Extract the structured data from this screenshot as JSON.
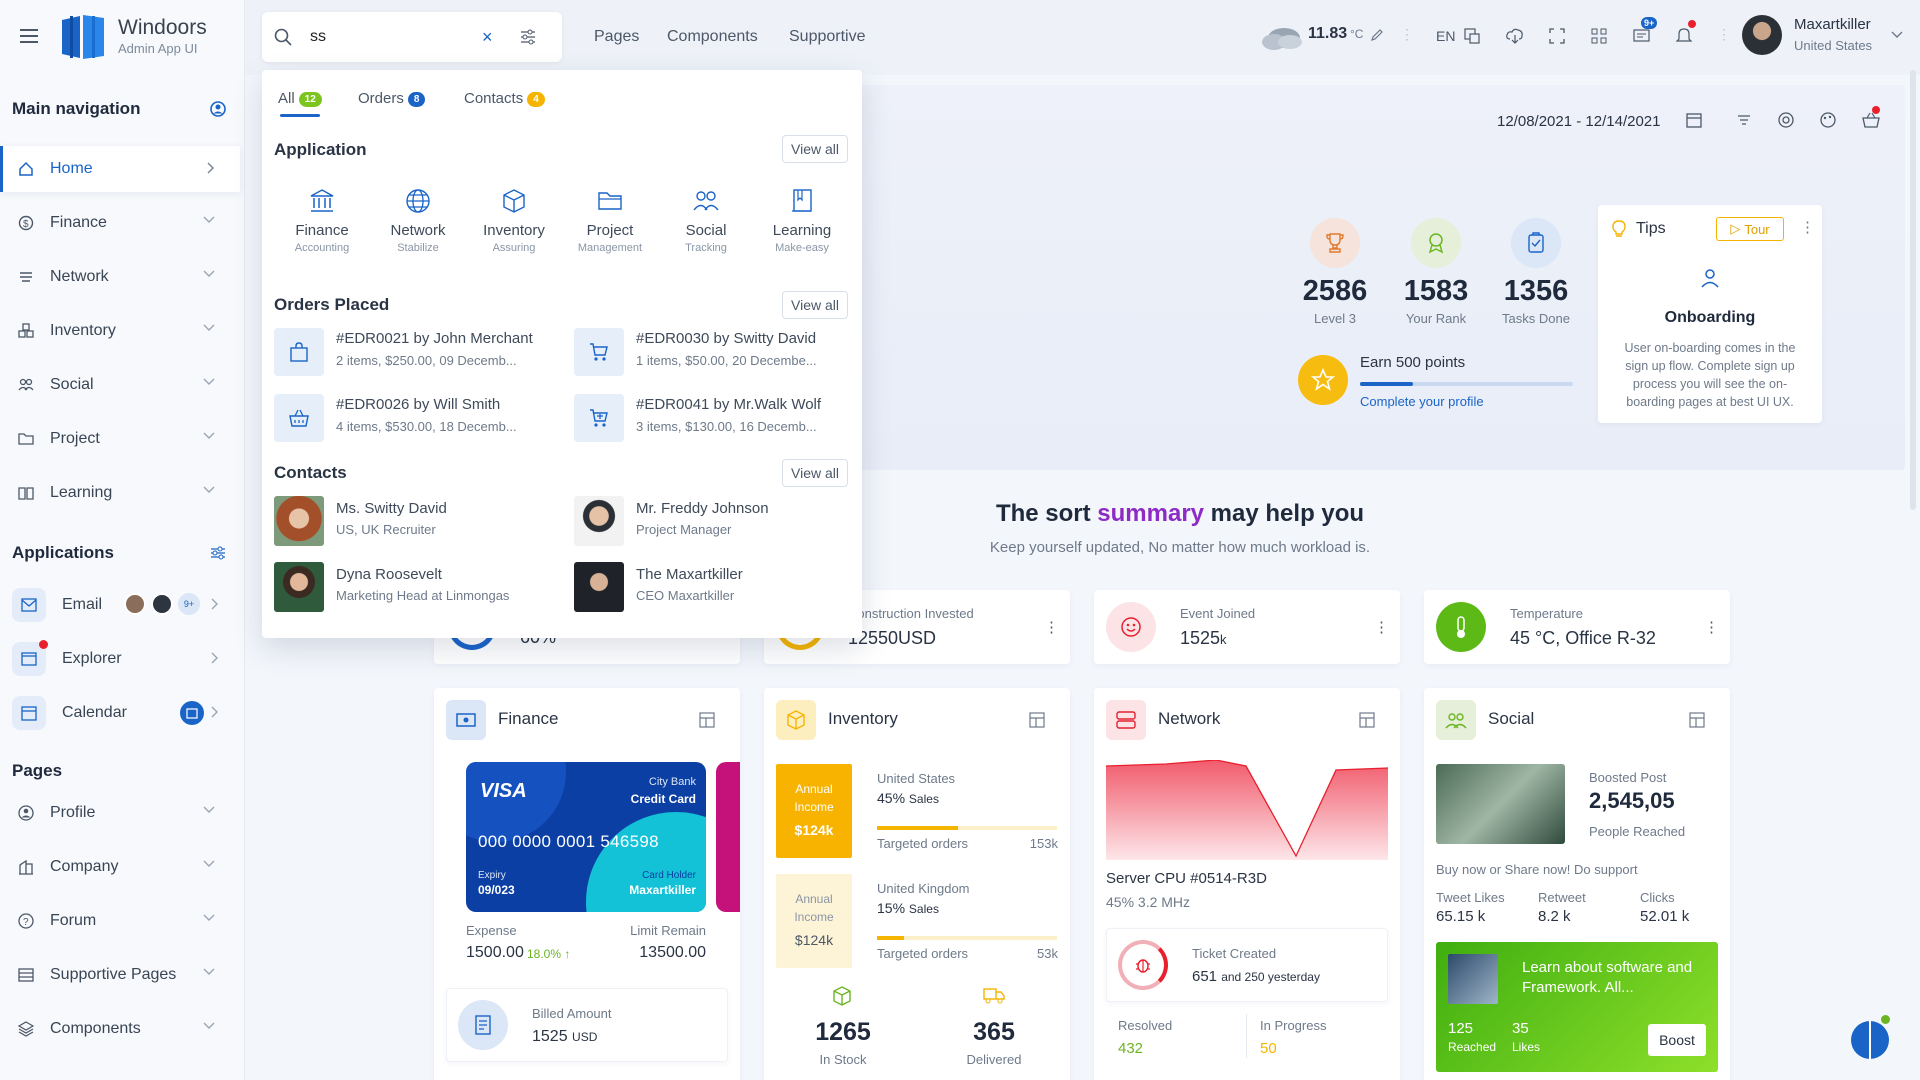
{
  "app": {
    "name": "Windoors",
    "subtitle": "Admin App UI"
  },
  "sidebar": {
    "main_nav_title": "Main navigation",
    "nav": [
      {
        "label": "Home",
        "active": true
      },
      {
        "label": "Finance"
      },
      {
        "label": "Network"
      },
      {
        "label": "Inventory"
      },
      {
        "label": "Social"
      },
      {
        "label": "Project"
      },
      {
        "label": "Learning"
      }
    ],
    "applications_title": "Applications",
    "apps": [
      {
        "label": "Email",
        "badge": "9+"
      },
      {
        "label": "Explorer"
      },
      {
        "label": "Calendar"
      }
    ],
    "pages_title": "Pages",
    "pages": [
      {
        "label": "Profile"
      },
      {
        "label": "Company"
      },
      {
        "label": "Forum"
      },
      {
        "label": "Supportive Pages"
      },
      {
        "label": "Components"
      }
    ]
  },
  "topbar": {
    "search_value": "ss",
    "links": [
      "Pages",
      "Components",
      "Supportive"
    ],
    "weather_temp": "11.83",
    "weather_unit": "°C",
    "lang": "EN",
    "chat_badge": "9+",
    "user_name": "Maxartkiller",
    "user_location": "United States"
  },
  "search_dropdown": {
    "tabs": [
      {
        "label": "All",
        "count": "12",
        "color": "#7cc520"
      },
      {
        "label": "Orders",
        "count": "8",
        "color": "#1a64c8"
      },
      {
        "label": "Contacts",
        "count": "4",
        "color": "#f5b400"
      }
    ],
    "application_title": "Application",
    "view_all": "View all",
    "apps": [
      {
        "title": "Finance",
        "sub": "Accounting",
        "icon": "bank-icon"
      },
      {
        "title": "Network",
        "sub": "Stabilize",
        "icon": "globe-icon"
      },
      {
        "title": "Inventory",
        "sub": "Assuring",
        "icon": "box-icon"
      },
      {
        "title": "Project",
        "sub": "Management",
        "icon": "folder-icon"
      },
      {
        "title": "Social",
        "sub": "Tracking",
        "icon": "people-icon"
      },
      {
        "title": "Learning",
        "sub": "Make-easy",
        "icon": "book-icon"
      }
    ],
    "orders_title": "Orders Placed",
    "orders": [
      {
        "title": "#EDR0021 by John Merchant",
        "sub": "2 items, $250.00, 09 Decemb...",
        "icon": "bag-icon"
      },
      {
        "title": "#EDR0030 by Switty David",
        "sub": "1 items, $50.00, 20 Decembe...",
        "icon": "cart-icon"
      },
      {
        "title": "#EDR0026 by Will Smith",
        "sub": "4 items, $530.00, 18 Decemb...",
        "icon": "basket-icon"
      },
      {
        "title": "#EDR0041 by Mr.Walk Wolf",
        "sub": "3 items, $130.00, 16 Decemb...",
        "icon": "cart-plus-icon"
      }
    ],
    "contacts_title": "Contacts",
    "contacts": [
      {
        "name": "Ms. Switty David",
        "role": "US, UK Recruiter"
      },
      {
        "name": "Mr. Freddy Johnson",
        "role": "Project Manager"
      },
      {
        "name": "Dyna Roosevelt",
        "role": "Marketing Head at Linmongas"
      },
      {
        "name": "The Maxartkiller",
        "role": "CEO Maxartkiller"
      }
    ]
  },
  "dashboard": {
    "date_range": "12/08/2021 - 12/14/2021",
    "stats": [
      {
        "value": "2586",
        "label": "Level 3",
        "color": "#f5e3dc"
      },
      {
        "value": "1583",
        "label": "Your Rank",
        "color": "#e5efd9"
      },
      {
        "value": "1356",
        "label": "Tasks Done",
        "color": "#dbe6f6"
      }
    ],
    "earn_title": "Earn 500 points",
    "earn_link": "Complete your profile",
    "earn_progress": 0.25,
    "tips": {
      "title": "Tips",
      "tour": "Tour",
      "heading": "Onboarding",
      "text": "User on-boarding comes in the sign up flow. Complete sign up process you will see the on-boarding pages at best UI UX."
    },
    "summary_pre": "The sort ",
    "summary_hl": "summary",
    "summary_post": " may help you",
    "summary_sub": "Keep yourself updated, No matter how much workload is.",
    "mini": [
      {
        "label": "",
        "value": "60%"
      },
      {
        "label": "Construction Invested",
        "value": "12550USD"
      },
      {
        "label": "Event Joined",
        "value": "1525",
        "unit": "k"
      },
      {
        "label": "Temperature",
        "value": "45 °C, Office R-32"
      }
    ],
    "finance": {
      "title": "Finance",
      "card_brand": "VISA",
      "card_bank": "City Bank",
      "card_type": "Credit Card",
      "card_number": "000 0000 0001 546598",
      "expiry_label": "Expiry",
      "expiry": "09/023",
      "holder_label": "Card Holder",
      "holder": "Maxartkiller",
      "expense_label": "Expense",
      "expense": "1500.00",
      "expense_change": "18.0%",
      "limit_label": "Limit Remain",
      "limit": "13500.00",
      "billed_label": "Billed Amount",
      "billed": "1525",
      "billed_unit": "USD"
    },
    "inventory": {
      "title": "Inventory",
      "rows": [
        {
          "box_label": "Annual Income",
          "box_value": "$124k",
          "region": "United States",
          "sales": "45%",
          "sales_suffix": "Sales",
          "target_label": "Targeted orders",
          "target": "153k",
          "progress": 0.45
        },
        {
          "box_label": "Annual Income",
          "box_value": "$124k",
          "region": "United Kingdom",
          "sales": "15%",
          "sales_suffix": "Sales",
          "target_label": "Targeted orders",
          "target": "53k",
          "progress": 0.15
        }
      ],
      "in_stock": "1265",
      "in_stock_label": "In Stock",
      "delivered": "365",
      "delivered_label": "Delivered"
    },
    "network": {
      "title": "Network",
      "server": "Server CPU #0514-R3D",
      "freq": "45% 3.2 MHz",
      "ticket_label": "Ticket Created",
      "ticket_value": "651",
      "ticket_suffix": "and 250 yesterday",
      "resolved_label": "Resolved",
      "resolved": "432",
      "progress_label": "In Progress",
      "progress": "50"
    },
    "social": {
      "title": "Social",
      "boost_label": "Boosted Post",
      "boost_value": "2,545,05",
      "reached_label": "People Reached",
      "cta": "Buy now or Share now! Do support",
      "metrics": [
        {
          "label": "Tweet Likes",
          "value": "65.15 k"
        },
        {
          "label": "Retweet",
          "value": "8.2 k"
        },
        {
          "label": "Clicks",
          "value": "52.01 k"
        }
      ],
      "promo_title": "Learn about software and Framework. All...",
      "promo_reached": "125",
      "promo_reached_label": "Reached",
      "promo_likes": "35",
      "promo_likes_label": "Likes",
      "boost_btn": "Boost"
    }
  }
}
